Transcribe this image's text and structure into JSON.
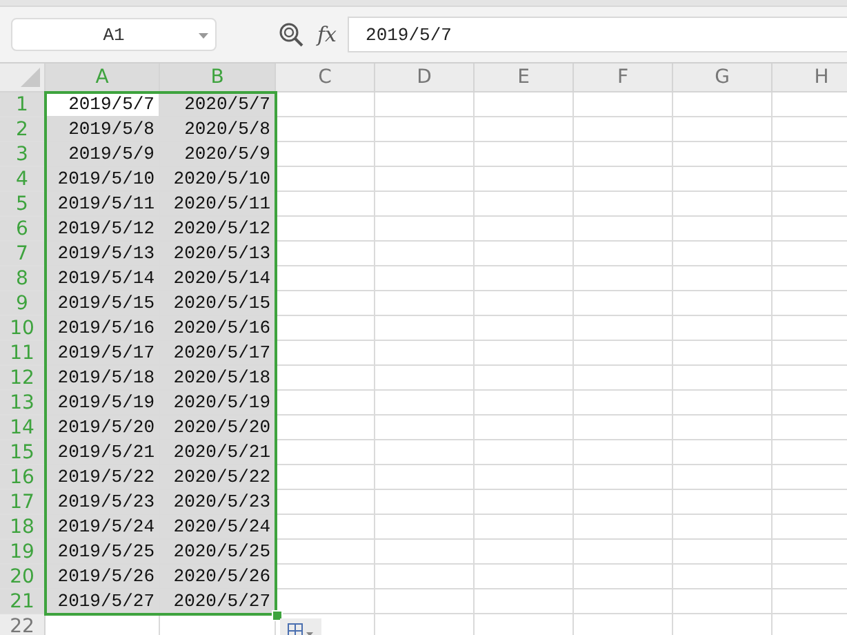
{
  "name_box": {
    "value": "A1"
  },
  "formula_bar": {
    "function_label": "fx",
    "value": "2019/5/7"
  },
  "columns": [
    {
      "label": "A",
      "selected": true
    },
    {
      "label": "B",
      "selected": true
    },
    {
      "label": "C",
      "selected": false
    },
    {
      "label": "D",
      "selected": false
    },
    {
      "label": "E",
      "selected": false
    },
    {
      "label": "F",
      "selected": false
    },
    {
      "label": "G",
      "selected": false
    },
    {
      "label": "H",
      "selected": false
    }
  ],
  "rows": [
    {
      "label": "1",
      "selected": true,
      "cells": [
        {
          "value": "2019/5/7",
          "active": true
        },
        {
          "value": "2020/5/7",
          "active": false
        }
      ]
    },
    {
      "label": "2",
      "selected": true,
      "cells": [
        {
          "value": "2019/5/8",
          "active": false
        },
        {
          "value": "2020/5/8",
          "active": false
        }
      ]
    },
    {
      "label": "3",
      "selected": true,
      "cells": [
        {
          "value": "2019/5/9",
          "active": false
        },
        {
          "value": "2020/5/9",
          "active": false
        }
      ]
    },
    {
      "label": "4",
      "selected": true,
      "cells": [
        {
          "value": "2019/5/10",
          "active": false
        },
        {
          "value": "2020/5/10",
          "active": false
        }
      ]
    },
    {
      "label": "5",
      "selected": true,
      "cells": [
        {
          "value": "2019/5/11",
          "active": false
        },
        {
          "value": "2020/5/11",
          "active": false
        }
      ]
    },
    {
      "label": "6",
      "selected": true,
      "cells": [
        {
          "value": "2019/5/12",
          "active": false
        },
        {
          "value": "2020/5/12",
          "active": false
        }
      ]
    },
    {
      "label": "7",
      "selected": true,
      "cells": [
        {
          "value": "2019/5/13",
          "active": false
        },
        {
          "value": "2020/5/13",
          "active": false
        }
      ]
    },
    {
      "label": "8",
      "selected": true,
      "cells": [
        {
          "value": "2019/5/14",
          "active": false
        },
        {
          "value": "2020/5/14",
          "active": false
        }
      ]
    },
    {
      "label": "9",
      "selected": true,
      "cells": [
        {
          "value": "2019/5/15",
          "active": false
        },
        {
          "value": "2020/5/15",
          "active": false
        }
      ]
    },
    {
      "label": "10",
      "selected": true,
      "cells": [
        {
          "value": "2019/5/16",
          "active": false
        },
        {
          "value": "2020/5/16",
          "active": false
        }
      ]
    },
    {
      "label": "11",
      "selected": true,
      "cells": [
        {
          "value": "2019/5/17",
          "active": false
        },
        {
          "value": "2020/5/17",
          "active": false
        }
      ]
    },
    {
      "label": "12",
      "selected": true,
      "cells": [
        {
          "value": "2019/5/18",
          "active": false
        },
        {
          "value": "2020/5/18",
          "active": false
        }
      ]
    },
    {
      "label": "13",
      "selected": true,
      "cells": [
        {
          "value": "2019/5/19",
          "active": false
        },
        {
          "value": "2020/5/19",
          "active": false
        }
      ]
    },
    {
      "label": "14",
      "selected": true,
      "cells": [
        {
          "value": "2019/5/20",
          "active": false
        },
        {
          "value": "2020/5/20",
          "active": false
        }
      ]
    },
    {
      "label": "15",
      "selected": true,
      "cells": [
        {
          "value": "2019/5/21",
          "active": false
        },
        {
          "value": "2020/5/21",
          "active": false
        }
      ]
    },
    {
      "label": "16",
      "selected": true,
      "cells": [
        {
          "value": "2019/5/22",
          "active": false
        },
        {
          "value": "2020/5/22",
          "active": false
        }
      ]
    },
    {
      "label": "17",
      "selected": true,
      "cells": [
        {
          "value": "2019/5/23",
          "active": false
        },
        {
          "value": "2020/5/23",
          "active": false
        }
      ]
    },
    {
      "label": "18",
      "selected": true,
      "cells": [
        {
          "value": "2019/5/24",
          "active": false
        },
        {
          "value": "2020/5/24",
          "active": false
        }
      ]
    },
    {
      "label": "19",
      "selected": true,
      "cells": [
        {
          "value": "2019/5/25",
          "active": false
        },
        {
          "value": "2020/5/25",
          "active": false
        }
      ]
    },
    {
      "label": "20",
      "selected": true,
      "cells": [
        {
          "value": "2019/5/26",
          "active": false
        },
        {
          "value": "2020/5/26",
          "active": false
        }
      ]
    },
    {
      "label": "21",
      "selected": true,
      "cells": [
        {
          "value": "2019/5/27",
          "active": false
        },
        {
          "value": "2020/5/27",
          "active": false
        }
      ]
    },
    {
      "label": "22",
      "selected": false
    }
  ]
}
